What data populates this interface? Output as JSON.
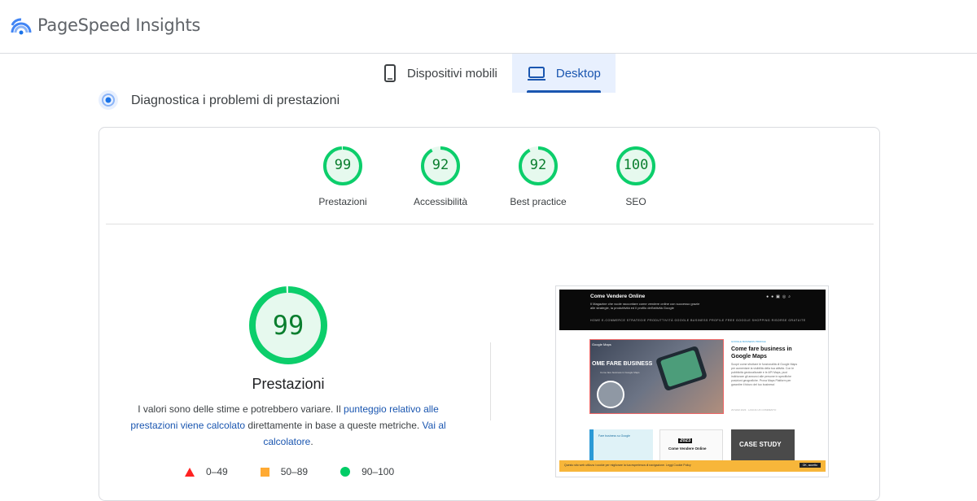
{
  "header": {
    "app_title": "PageSpeed Insights",
    "logo_icon": "pagespeed-logo-icon"
  },
  "tabs": [
    {
      "label": "Dispositivi mobili",
      "icon": "smartphone-icon",
      "active": false
    },
    {
      "label": "Desktop",
      "icon": "laptop-icon",
      "active": true
    }
  ],
  "section": {
    "title": "Diagnostica i problemi di prestazioni",
    "icon": "performance-diagnostics-icon"
  },
  "categories": [
    {
      "label": "Prestazioni",
      "score": "99",
      "fraction": 0.99
    },
    {
      "label": "Accessibilità",
      "score": "92",
      "fraction": 0.92
    },
    {
      "label": "Best practice",
      "score": "92",
      "fraction": 0.92
    },
    {
      "label": "SEO",
      "score": "100",
      "fraction": 1.0
    }
  ],
  "performance": {
    "score": "99",
    "fraction": 0.99,
    "title": "Prestazioni",
    "desc_part1": "I valori sono delle stime e potrebbero variare. Il ",
    "desc_link1": "punteggio relativo alle prestazioni viene calcolato",
    "desc_part2": " direttamente in base a queste metriche. ",
    "desc_link2": "Vai al calcolatore",
    "desc_part3": "."
  },
  "legend": [
    {
      "range": "0–49",
      "shape": "triangle",
      "color": "#ff3333"
    },
    {
      "range": "50–89",
      "shape": "square",
      "color": "#ffaa33"
    },
    {
      "range": "90–100",
      "shape": "circle",
      "color": "#00cc66"
    }
  ],
  "colors": {
    "pass": "#0cce6b",
    "pass_text": "#0a7e2e",
    "pass_bg": "#e6f9ee",
    "accent": "#1a56b0"
  },
  "thumbnail": {
    "site_title": "Come Vendere Online",
    "tagline": "Il Magazine che vuole raccontare come vendere online con successo grazie alle strategie, la produttività ed il profilo dell'attività Google",
    "nav": "HOME   E-COMMERCE   STRATEGIE   PRODUTTIVITÀ   GOOGLE BUSINESS PROFILE   FREE GOOGLE SHOPPING   RISORSE GRATUITE",
    "hero_tag": "Google Maps",
    "hero_text": "OME FARE BUSINESS",
    "hero_sub": "Come fare business in Google Maps",
    "post_category": "GOOGLE BUSINESS PROFILE",
    "post_title": "Come fare business in Google Maps",
    "post_body": "Scopri come sfruttare le funzionalità di Google Maps per aumentare la visibilità della tua attività. Con le pubblicità geolocalizzate e le API Maps, puoi indirizzare gli annunci alle persone in specifiche posizioni geografiche. Prova Maps Platform per garantire il futuro del tuo business!",
    "post_meta": "29 MAR 2023   ·   LASCIA UN COMMENTO",
    "card1_title": "Fare business su Google",
    "card2_year": "2023",
    "card2_title": "Come Vendere Online",
    "card3_title": "CASE STUDY",
    "cookie_text": "Questo sito web utilizza i cookie per migliorare la tua esperienza di navigazione. Leggi Cookie Policy",
    "cookie_button": "OK, accetto"
  }
}
